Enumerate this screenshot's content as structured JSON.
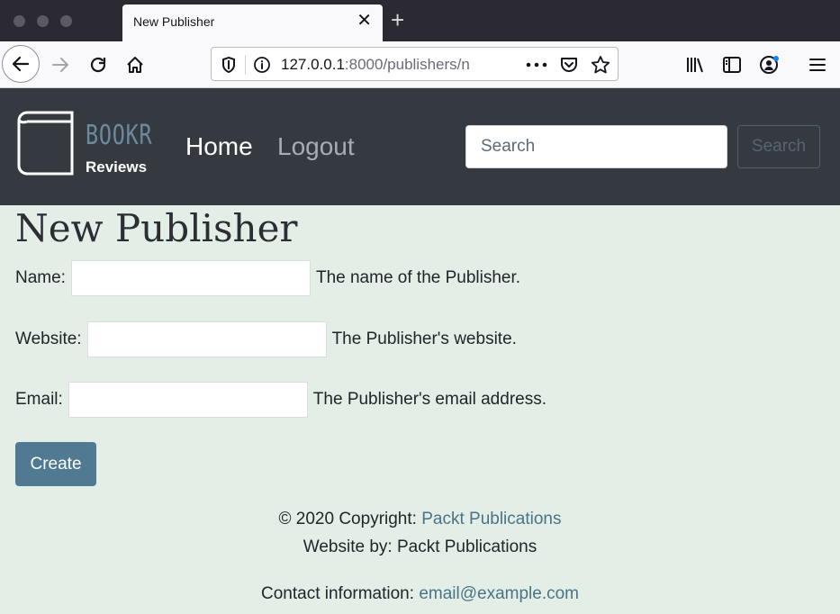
{
  "browser": {
    "tab_title": "New Publisher",
    "tab_close_glyph": "✕",
    "new_tab_glyph": "+",
    "url_host": "127.0.0.1",
    "url_path": ":8000/publishers/n",
    "icons": [
      "back-icon",
      "forward-icon",
      "reload-icon",
      "home-icon",
      "shield-icon",
      "info-icon",
      "more-icon",
      "pocket-icon",
      "star-icon",
      "library-icon",
      "sidebar-icon",
      "account-icon",
      "menu-icon"
    ]
  },
  "navbar": {
    "brand_name": "BOOKR",
    "brand_sub": "Reviews",
    "home_label": "Home",
    "logout_label": "Logout",
    "search_placeholder": "Search",
    "search_button": "Search"
  },
  "main": {
    "title": "New Publisher",
    "fields": [
      {
        "label": "Name:",
        "help": "The name of the Publisher.",
        "value": ""
      },
      {
        "label": "Website:",
        "help": "The Publisher's website.",
        "value": ""
      },
      {
        "label": "Email:",
        "help": "The Publisher's email address.",
        "value": ""
      }
    ],
    "submit_label": "Create"
  },
  "footer": {
    "copyright_prefix": "© 2020 Copyright: ",
    "copyright_link": "Packt Publications",
    "website_by": "Website by: Packt Publications",
    "contact_prefix": "Contact information: ",
    "contact_email": "email@example.com"
  },
  "colors": {
    "page_bg": "#e3efe6",
    "navbar_bg": "#343a40",
    "accent": "#507a91",
    "link": "#4a7388"
  }
}
